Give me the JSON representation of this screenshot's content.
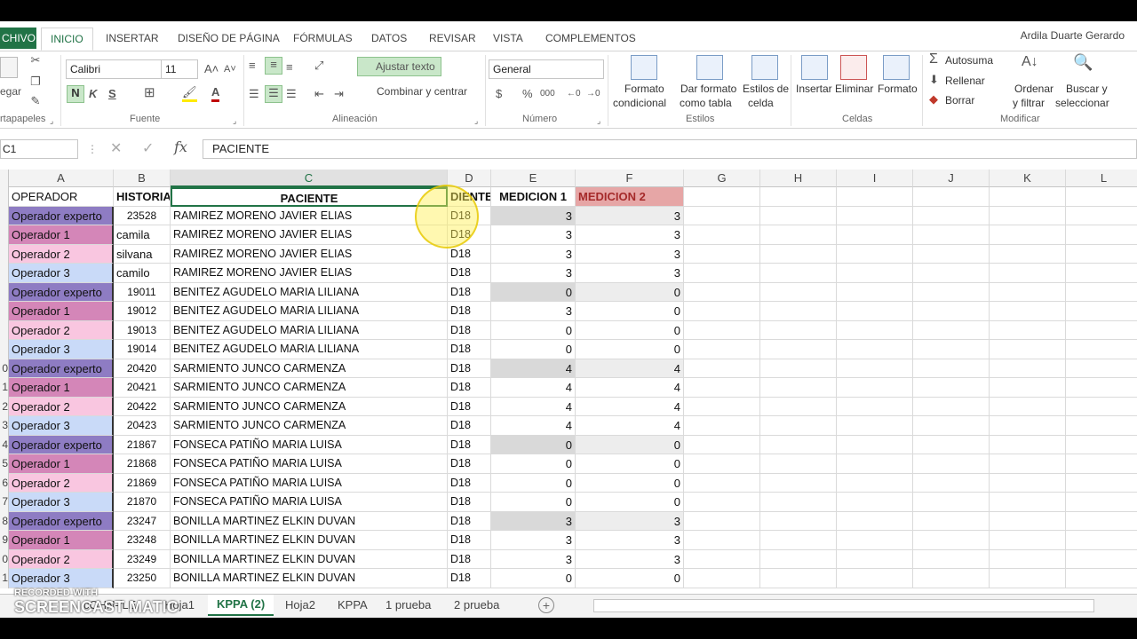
{
  "ribbon_tabs": [
    "CHIVO",
    "INICIO",
    "INSERTAR",
    "DISEÑO DE PÁGINA",
    "FÓRMULAS",
    "DATOS",
    "REVISAR",
    "VISTA",
    "COMPLEMENTOS"
  ],
  "user_name": "Ardila Duarte Gerardo",
  "clipboard": {
    "paste_label": "egar",
    "group_label": "rtapapeles"
  },
  "font": {
    "name": "Calibri",
    "size": "11",
    "bold": "N",
    "italic": "K",
    "underline": "S",
    "group_label": "Fuente"
  },
  "alignment": {
    "wrap_text": "Ajustar texto",
    "merge_center": "Combinar y centrar",
    "group_label": "Alineación"
  },
  "number": {
    "format": "General",
    "currency": "$",
    "percent": "%",
    "thousands": "000",
    "group_label": "Número"
  },
  "styles": {
    "conditional": [
      "Formato",
      "condicional"
    ],
    "as_table": [
      "Dar formato",
      "como tabla"
    ],
    "cell_styles": [
      "Estilos de",
      "celda"
    ],
    "group_label": "Estilos"
  },
  "cells": {
    "insert": "Insertar",
    "delete": "Eliminar",
    "format": "Formato",
    "group_label": "Celdas"
  },
  "editing": {
    "autosum": "Autosuma",
    "fill": "Rellenar",
    "clear": "Borrar",
    "sort": [
      "Ordenar",
      "y filtrar"
    ],
    "find": [
      "Buscar y",
      "seleccionar"
    ],
    "group_label": "Modificar"
  },
  "formula_bar": {
    "name_box": "C1",
    "fx": "fx",
    "content": "PACIENTE"
  },
  "columns": [
    "A",
    "B",
    "C",
    "D",
    "E",
    "F",
    "G",
    "H",
    "I",
    "J",
    "K",
    "L"
  ],
  "row_numbers": [
    "",
    "",
    "",
    "",
    "",
    "",
    "",
    "",
    "",
    "0",
    "1",
    "2",
    "3",
    "4",
    "5",
    "6",
    "7",
    "8",
    "9",
    "0",
    "1"
  ],
  "headers": {
    "operador": "OPERADOR",
    "historia": "HISTORIA",
    "paciente": "PACIENTE",
    "diente": "DIENTE",
    "medicion1": "MEDICION 1",
    "medicion2": "MEDICION 2"
  },
  "rows": [
    {
      "operador": "Operador experto",
      "historia": "23528",
      "paciente": "RAMIREZ MORENO JAVIER ELIAS",
      "diente": "D18",
      "m1": "3",
      "m2": "3"
    },
    {
      "operador": "Operador 1",
      "historia": "camila",
      "paciente": "RAMIREZ MORENO JAVIER ELIAS",
      "diente": "D18",
      "m1": "3",
      "m2": "3"
    },
    {
      "operador": "Operador 2",
      "historia": "silvana",
      "paciente": "RAMIREZ MORENO JAVIER ELIAS",
      "diente": "D18",
      "m1": "3",
      "m2": "3"
    },
    {
      "operador": "Operador 3",
      "historia": "camilo",
      "paciente": "RAMIREZ MORENO JAVIER ELIAS",
      "diente": "D18",
      "m1": "3",
      "m2": "3"
    },
    {
      "operador": "Operador experto",
      "historia": "19011",
      "paciente": "BENITEZ AGUDELO MARIA LILIANA",
      "diente": "D18",
      "m1": "0",
      "m2": "0"
    },
    {
      "operador": "Operador 1",
      "historia": "19012",
      "paciente": "BENITEZ AGUDELO MARIA LILIANA",
      "diente": "D18",
      "m1": "3",
      "m2": "0"
    },
    {
      "operador": "Operador 2",
      "historia": "19013",
      "paciente": "BENITEZ AGUDELO MARIA LILIANA",
      "diente": "D18",
      "m1": "0",
      "m2": "0"
    },
    {
      "operador": "Operador 3",
      "historia": "19014",
      "paciente": "BENITEZ AGUDELO MARIA LILIANA",
      "diente": "D18",
      "m1": "0",
      "m2": "0"
    },
    {
      "operador": "Operador experto",
      "historia": "20420",
      "paciente": "SARMIENTO JUNCO  CARMENZA",
      "diente": "D18",
      "m1": "4",
      "m2": "4"
    },
    {
      "operador": "Operador 1",
      "historia": "20421",
      "paciente": "SARMIENTO JUNCO  CARMENZA",
      "diente": "D18",
      "m1": "4",
      "m2": "4"
    },
    {
      "operador": "Operador 2",
      "historia": "20422",
      "paciente": "SARMIENTO JUNCO  CARMENZA",
      "diente": "D18",
      "m1": "4",
      "m2": "4"
    },
    {
      "operador": "Operador 3",
      "historia": "20423",
      "paciente": "SARMIENTO JUNCO  CARMENZA",
      "diente": "D18",
      "m1": "4",
      "m2": "4"
    },
    {
      "operador": "Operador experto",
      "historia": "21867",
      "paciente": "FONSECA PATIÑO MARIA LUISA",
      "diente": "D18",
      "m1": "0",
      "m2": "0"
    },
    {
      "operador": "Operador 1",
      "historia": "21868",
      "paciente": "FONSECA PATIÑO MARIA LUISA",
      "diente": "D18",
      "m1": "0",
      "m2": "0"
    },
    {
      "operador": "Operador 2",
      "historia": "21869",
      "paciente": "FONSECA PATIÑO MARIA LUISA",
      "diente": "D18",
      "m1": "0",
      "m2": "0"
    },
    {
      "operador": "Operador 3",
      "historia": "21870",
      "paciente": "FONSECA PATIÑO MARIA LUISA",
      "diente": "D18",
      "m1": "0",
      "m2": "0"
    },
    {
      "operador": "Operador experto",
      "historia": "23247",
      "paciente": "BONILLA MARTINEZ ELKIN DUVAN",
      "diente": "D18",
      "m1": "3",
      "m2": "3"
    },
    {
      "operador": "Operador 1",
      "historia": "23248",
      "paciente": "BONILLA MARTINEZ ELKIN DUVAN",
      "diente": "D18",
      "m1": "3",
      "m2": "3"
    },
    {
      "operador": "Operador 2",
      "historia": "23249",
      "paciente": "BONILLA MARTINEZ ELKIN DUVAN",
      "diente": "D18",
      "m1": "3",
      "m2": "3"
    },
    {
      "operador": "Operador 3",
      "historia": "23250",
      "paciente": "BONILLA MARTINEZ ELKIN DUVAN",
      "diente": "D18",
      "m1": "0",
      "m2": "0"
    }
  ],
  "operator_colors": {
    "Operador experto": "#8e7cc3",
    "Operador 1": "#d486b8",
    "Operador 2": "#f9c6e0",
    "Operador 3": "#c9daf8"
  },
  "sheet_tabs": [
    "cOHN-fLE",
    "Hoja1",
    "KPPA (2)",
    "Hoja2",
    "KPPA",
    "1 prueba",
    "2 prueba"
  ],
  "active_sheet": "KPPA (2)",
  "watermark": {
    "top": "RECORDED WITH",
    "main": "SCREENCAST  MATIC"
  }
}
